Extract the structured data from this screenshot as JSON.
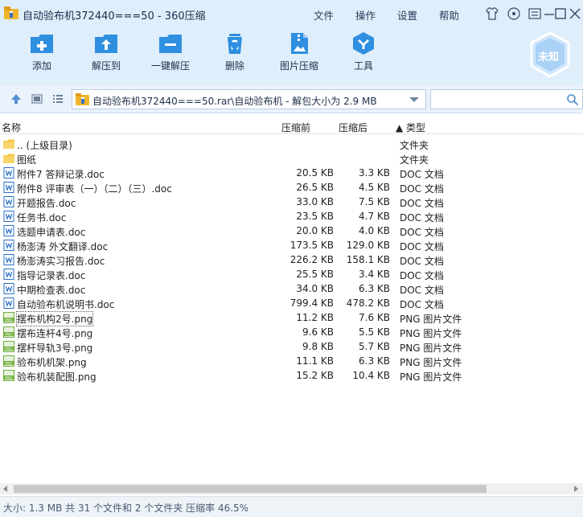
{
  "window": {
    "title": "自动验布机372440===50 - 360压缩",
    "menus": [
      "文件",
      "操作",
      "设置",
      "帮助"
    ]
  },
  "toolbar": {
    "items": [
      {
        "label": "添加",
        "icon": "add-icon"
      },
      {
        "label": "解压到",
        "icon": "extract-to-icon"
      },
      {
        "label": "一键解压",
        "icon": "one-click-extract-icon"
      },
      {
        "label": "删除",
        "icon": "delete-icon"
      },
      {
        "label": "图片压缩",
        "icon": "image-compress-icon"
      },
      {
        "label": "工具",
        "icon": "tools-icon"
      }
    ],
    "badge": "未知"
  },
  "address": {
    "path": "自动验布机372440===50.rar\\自动验布机 - 解包大小为 2.9 MB"
  },
  "columns": {
    "name": "名称",
    "size": "压缩前",
    "packed": "压缩后",
    "type": "▲ 类型"
  },
  "rows": [
    {
      "name": ".. (上级目录)",
      "size": "",
      "packed": "",
      "type": "文件夹",
      "kind": "folder"
    },
    {
      "name": "图纸",
      "size": "",
      "packed": "",
      "type": "文件夹",
      "kind": "folder"
    },
    {
      "name": "附件7  答辩记录.doc",
      "size": "20.5 KB",
      "packed": "3.3 KB",
      "type": "DOC 文档",
      "kind": "doc"
    },
    {
      "name": "附件8 评审表（一）（二）（三）.doc",
      "size": "26.5 KB",
      "packed": "4.5 KB",
      "type": "DOC 文档",
      "kind": "doc"
    },
    {
      "name": "开题报告.doc",
      "size": "33.0 KB",
      "packed": "7.5 KB",
      "type": "DOC 文档",
      "kind": "doc"
    },
    {
      "name": "任务书.doc",
      "size": "23.5 KB",
      "packed": "4.7 KB",
      "type": "DOC 文档",
      "kind": "doc"
    },
    {
      "name": "选题申请表.doc",
      "size": "20.0 KB",
      "packed": "4.0 KB",
      "type": "DOC 文档",
      "kind": "doc"
    },
    {
      "name": "杨澎涛  外文翻译.doc",
      "size": "173.5 KB",
      "packed": "129.0 KB",
      "type": "DOC 文档",
      "kind": "doc"
    },
    {
      "name": "杨澎涛实习报告.doc",
      "size": "226.2 KB",
      "packed": "158.1 KB",
      "type": "DOC 文档",
      "kind": "doc"
    },
    {
      "name": "指导记录表.doc",
      "size": "25.5 KB",
      "packed": "3.4 KB",
      "type": "DOC 文档",
      "kind": "doc"
    },
    {
      "name": "中期检查表.doc",
      "size": "34.0 KB",
      "packed": "6.3 KB",
      "type": "DOC 文档",
      "kind": "doc"
    },
    {
      "name": "自动验布机说明书.doc",
      "size": "799.4 KB",
      "packed": "478.2 KB",
      "type": "DOC 文档",
      "kind": "doc"
    },
    {
      "name": "摆布机构2号.png",
      "size": "11.2 KB",
      "packed": "7.6 KB",
      "type": "PNG 图片文件",
      "kind": "png"
    },
    {
      "name": "摆布连杆4号.png",
      "size": "9.6 KB",
      "packed": "5.5 KB",
      "type": "PNG 图片文件",
      "kind": "png"
    },
    {
      "name": "摆杆导轨3号.png",
      "size": "9.8 KB",
      "packed": "5.7 KB",
      "type": "PNG 图片文件",
      "kind": "png"
    },
    {
      "name": "验布机机架.png",
      "size": "11.1 KB",
      "packed": "6.3 KB",
      "type": "PNG 图片文件",
      "kind": "png"
    },
    {
      "name": "验布机装配图.png",
      "size": "15.2 KB",
      "packed": "10.4 KB",
      "type": "PNG 图片文件",
      "kind": "png"
    }
  ],
  "selected_row": 12,
  "status": {
    "text": "大小: 1.3 MB 共 31 个文件和 2 个文件夹 压缩率 46.5%"
  },
  "colors": {
    "accent": "#2f8fe0",
    "toolbar_bg": "#dfeefb",
    "folder": "#f6c94a",
    "doc": "#2b6fc6",
    "png": "#6fae3a"
  }
}
